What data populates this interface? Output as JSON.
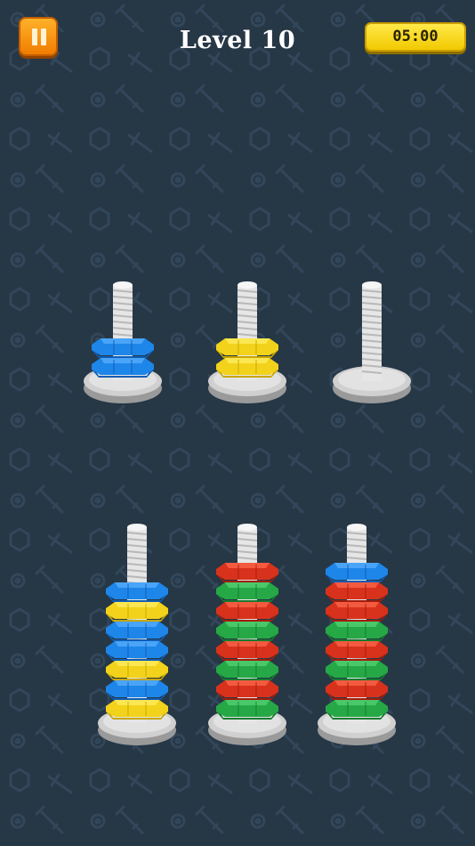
{
  "header": {
    "pause_icon": "pause-icon",
    "level_title": "Level 10",
    "timer": "05:00"
  },
  "colors": {
    "blue": "#1e86e8",
    "yellow": "#f2d21a",
    "red": "#d8321c",
    "green": "#26a846",
    "rod": "#e6e6e6",
    "base": "#d0d0d0",
    "background": "#263746"
  },
  "rods": [
    {
      "nuts": [
        "blue",
        "blue"
      ]
    },
    {
      "nuts": [
        "yellow",
        "yellow"
      ]
    },
    {
      "nuts": []
    },
    {
      "nuts": [
        "yellow",
        "blue",
        "yellow",
        "blue",
        "blue",
        "yellow",
        "blue"
      ]
    },
    {
      "nuts": [
        "green",
        "red",
        "green",
        "red",
        "green",
        "red",
        "green",
        "red"
      ]
    },
    {
      "nuts": [
        "green",
        "red",
        "green",
        "red",
        "green",
        "red",
        "red",
        "blue"
      ]
    }
  ]
}
